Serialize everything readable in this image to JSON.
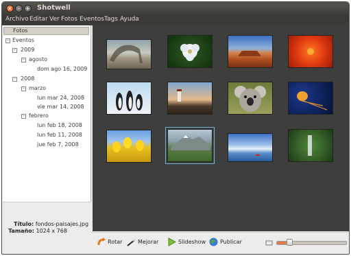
{
  "window": {
    "title": "Shotwell"
  },
  "menu": [
    "Archivo",
    "Editar",
    "Ver",
    "Fotos",
    "Eventos",
    "Tags",
    "Ayuda"
  ],
  "sidebar": {
    "header": "Fotos",
    "tree": {
      "root": "Eventos",
      "years": [
        {
          "label": "2009",
          "months": [
            {
              "label": "agosto",
              "days": [
                "dom ago 16, 2009"
              ]
            }
          ]
        },
        {
          "label": "2008",
          "months": [
            {
              "label": "marzo",
              "days": [
                "lun mar 24, 2008",
                "vie mar 14, 2008"
              ]
            },
            {
              "label": "febrero",
              "days": [
                "lun feb 18, 2008",
                "lun feb 11, 2008",
                "jue feb 7, 2008"
              ]
            }
          ]
        }
      ]
    }
  },
  "info": {
    "title_label": "Título:",
    "title_value": "fondos-paisajes.jpg",
    "size_label": "Tamaño:",
    "size_value": "1024 x 768"
  },
  "photos": [
    {
      "name": "tree-landscape",
      "selected": false
    },
    {
      "name": "white-flower",
      "selected": false
    },
    {
      "name": "desert-mesa",
      "selected": false
    },
    {
      "name": "red-flower",
      "selected": false
    },
    {
      "name": "penguins",
      "selected": false
    },
    {
      "name": "lighthouse",
      "selected": false
    },
    {
      "name": "koala",
      "selected": false
    },
    {
      "name": "jellyfish",
      "selected": false
    },
    {
      "name": "tulips",
      "selected": false
    },
    {
      "name": "mountain-landscape",
      "selected": true
    },
    {
      "name": "winter-lake",
      "selected": false
    },
    {
      "name": "waterfall",
      "selected": false
    }
  ],
  "toolbar": {
    "rotate_label": "Rotar",
    "enhance_label": "Mejorar",
    "slideshow_label": "Slideshow",
    "publish_label": "Publicar"
  },
  "zoom_slider": {
    "value": 0.14
  },
  "colors": {
    "accent": "#e07a4c",
    "selection": "#6bb6d9",
    "viewer_bg": "#3e3e3c",
    "titlebar": "#3c3b37"
  }
}
